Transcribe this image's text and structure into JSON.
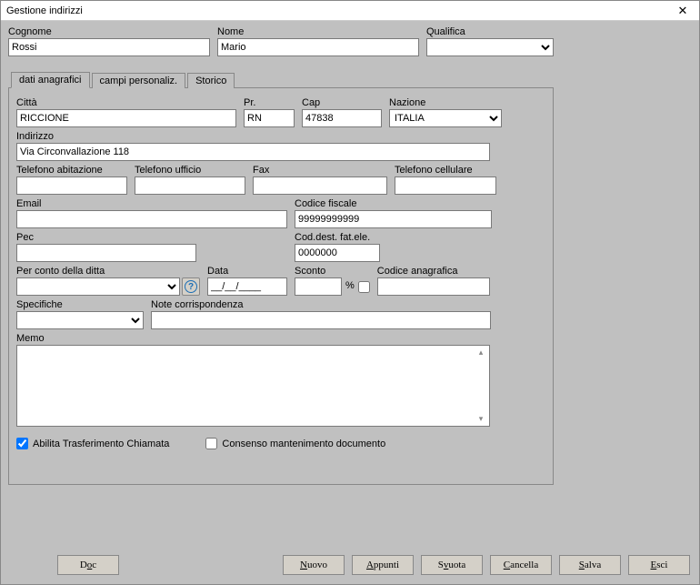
{
  "window": {
    "title": "Gestione indirizzi",
    "close": "✕"
  },
  "header": {
    "cognome_label": "Cognome",
    "cognome_value": "Rossi",
    "nome_label": "Nome",
    "nome_value": "Mario",
    "qualifica_label": "Qualifica",
    "qualifica_value": ""
  },
  "tabs": {
    "anagrafici": "dati anagrafici",
    "personaliz": "campi personaliz.",
    "storico": "Storico"
  },
  "anag": {
    "citta_label": "Città",
    "citta_value": "RICCIONE",
    "pr_label": "Pr.",
    "pr_value": "RN",
    "cap_label": "Cap",
    "cap_value": "47838",
    "nazione_label": "Nazione",
    "nazione_value": "ITALIA",
    "indirizzo_label": "Indirizzo",
    "indirizzo_value": "Via Circonvallazione 118",
    "tel_ab_label": "Telefono abitazione",
    "tel_ab_value": "",
    "tel_uf_label": "Telefono ufficio",
    "tel_uf_value": "",
    "fax_label": "Fax",
    "fax_value": "",
    "tel_cel_label": "Telefono cellulare",
    "tel_cel_value": "",
    "email_label": "Email",
    "email_value": "",
    "cf_label": "Codice fiscale",
    "cf_value": "99999999999",
    "pec_label": "Pec",
    "pec_value": "",
    "coddest_label": "Cod.dest. fat.ele.",
    "coddest_value": "0000000",
    "perconto_label": "Per conto della ditta",
    "perconto_value": "",
    "data_label": "Data",
    "data_value": "__/__/____",
    "sconto_label": "Sconto",
    "sconto_value": "",
    "sconto_pct": "%",
    "codanag_label": "Codice anagrafica",
    "codanag_value": "",
    "spec_label": "Specifiche",
    "spec_value": "",
    "note_label": "Note corrispondenza",
    "note_value": "",
    "memo_label": "Memo",
    "memo_value": "",
    "abilita_label": "Abilita Trasferimento Chiamata",
    "consenso_label": "Consenso mantenimento documento"
  },
  "buttons": {
    "doc_pre": "D",
    "doc_ul": "o",
    "doc_post": "c",
    "nuovo_pre": "",
    "nuovo_ul": "N",
    "nuovo_post": "uovo",
    "appunti_pre": "",
    "appunti_ul": "A",
    "appunti_post": "ppunti",
    "svuota_pre": "S",
    "svuota_ul": "v",
    "svuota_post": "uota",
    "cancella_pre": "",
    "cancella_ul": "C",
    "cancella_post": "ancella",
    "salva_pre": "",
    "salva_ul": "S",
    "salva_post": "alva",
    "esci_pre": "",
    "esci_ul": "E",
    "esci_post": "sci"
  }
}
